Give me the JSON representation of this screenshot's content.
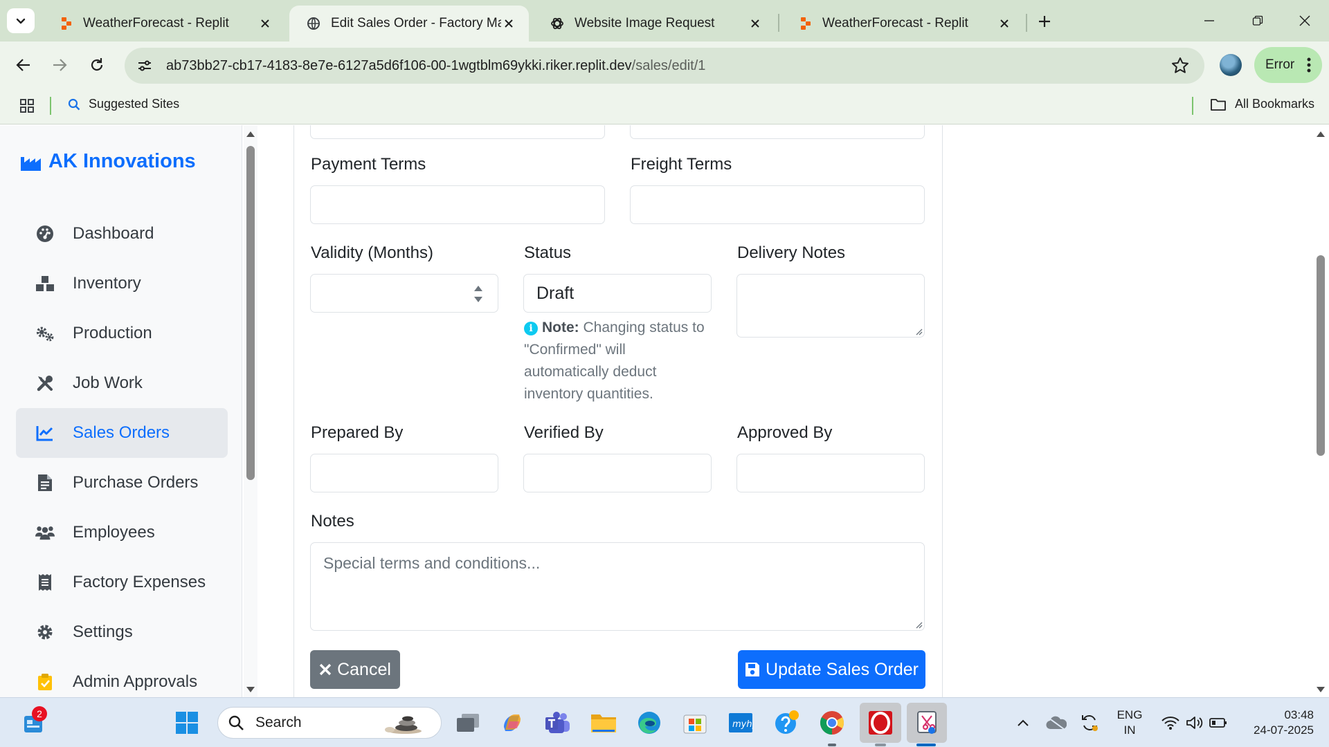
{
  "browser": {
    "tabs": [
      {
        "title": "WeatherForecast - Replit",
        "icon": "replit-favicon"
      },
      {
        "title": "Edit Sales Order - Factory Mana",
        "icon": "globe-favicon",
        "active": true
      },
      {
        "title": "Website Image Request",
        "icon": "chatgpt-favicon"
      },
      {
        "title": "WeatherForecast - Replit",
        "icon": "replit-favicon"
      }
    ],
    "url_host": "ab73bb27-cb17-4183-8e7e-6127a5d6f106-00-1wgtblm69ykki.riker.replit.dev",
    "url_path": "/sales/edit/1",
    "profile_status": "Error",
    "bookmarks": {
      "suggested": "Suggested Sites",
      "all": "All Bookmarks"
    },
    "colors": {
      "frame": "#d4e3d0",
      "toolbar": "#eef4ec",
      "error_chip": "#b9e8b3"
    }
  },
  "sidebar": {
    "brand": "AK Innovations",
    "items": [
      {
        "label": "Dashboard",
        "icon": "gauge-icon"
      },
      {
        "label": "Inventory",
        "icon": "boxes-icon"
      },
      {
        "label": "Production",
        "icon": "cogs-icon"
      },
      {
        "label": "Job Work",
        "icon": "tools-icon"
      },
      {
        "label": "Sales Orders",
        "icon": "chart-line-icon",
        "active": true
      },
      {
        "label": "Purchase Orders",
        "icon": "file-invoice-icon"
      },
      {
        "label": "Employees",
        "icon": "users-icon"
      },
      {
        "label": "Factory Expenses",
        "icon": "receipt-icon"
      },
      {
        "label": "Settings",
        "icon": "gear-icon"
      },
      {
        "label": "Admin Approvals",
        "icon": "clipboard-check-icon"
      }
    ],
    "colors": {
      "accent": "#0d6efd",
      "active_bg": "#e6e9ed"
    }
  },
  "form": {
    "payment_terms": {
      "label": "Payment Terms",
      "value": ""
    },
    "freight_terms": {
      "label": "Freight Terms",
      "value": ""
    },
    "validity": {
      "label": "Validity (Months)",
      "value": ""
    },
    "status": {
      "label": "Status",
      "value": "Draft"
    },
    "delivery_notes": {
      "label": "Delivery Notes",
      "value": ""
    },
    "status_note": {
      "prefix": "Note:",
      "text": " Changing status to \"Confirmed\" will automatically deduct inventory quantities."
    },
    "prepared_by": {
      "label": "Prepared By",
      "value": ""
    },
    "verified_by": {
      "label": "Verified By",
      "value": ""
    },
    "approved_by": {
      "label": "Approved By",
      "value": ""
    },
    "notes": {
      "label": "Notes",
      "placeholder": "Special terms and conditions..."
    },
    "cancel_label": "Cancel",
    "submit_label": "Update Sales Order",
    "colors": {
      "primary": "#0d6efd",
      "secondary": "#6c757d",
      "info": "#0dcaf0"
    }
  },
  "taskbar": {
    "notification_count": "2",
    "search_placeholder": "Search",
    "apps": [
      "windows-start",
      "task-view",
      "copilot",
      "teams",
      "file-explorer",
      "edge",
      "microsoft-store",
      "myhp",
      "get-help",
      "chrome",
      "opera",
      "snipping-tool"
    ],
    "language": "ENG",
    "region": "IN",
    "time": "03:48",
    "date": "24-07-2025"
  }
}
